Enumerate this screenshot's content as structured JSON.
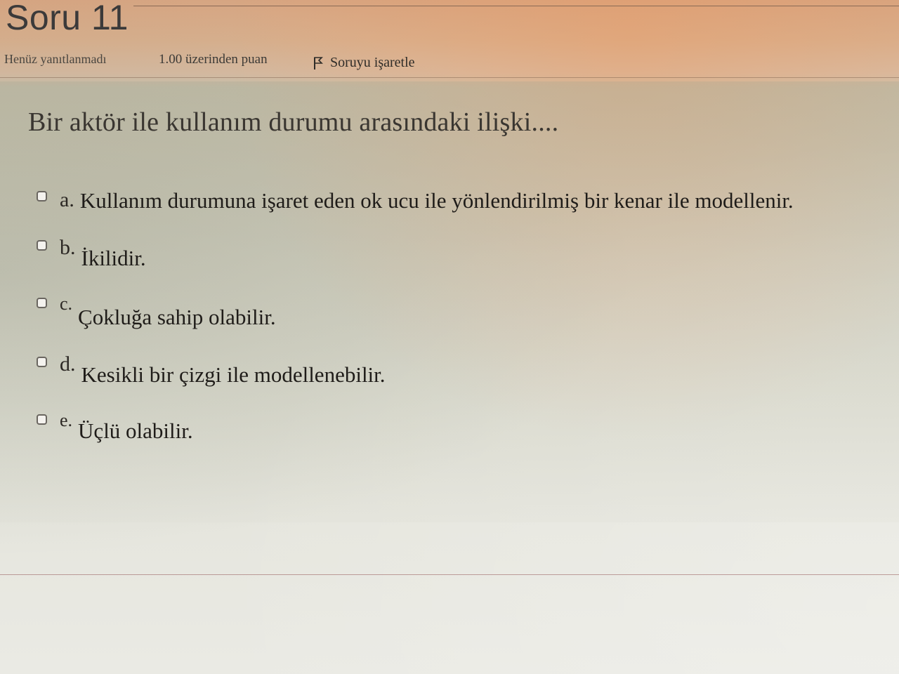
{
  "header": {
    "title": "Soru 11",
    "status": "Henüz yanıtlanmadı",
    "points": "1.00 üzerinden puan",
    "flag_label": "Soruyu işaretle",
    "flag_icon": "flag-icon"
  },
  "question": {
    "text": "Bir aktör ile kullanım durumu arasındaki ilişki...."
  },
  "options": [
    {
      "letter": "a.",
      "text": "Kullanım durumuna işaret eden ok ucu ile yönlendirilmiş bir kenar ile modellenir.",
      "checked": false
    },
    {
      "letter": "b.",
      "text": "İkilidir.",
      "checked": false
    },
    {
      "letter": "c.",
      "text": "Çokluğa sahip olabilir.",
      "checked": false
    },
    {
      "letter": "d.",
      "text": "Kesikli bir çizgi ile modellenebilir.",
      "checked": false
    },
    {
      "letter": "e.",
      "text": "Üçlü olabilir.",
      "checked": false
    }
  ]
}
